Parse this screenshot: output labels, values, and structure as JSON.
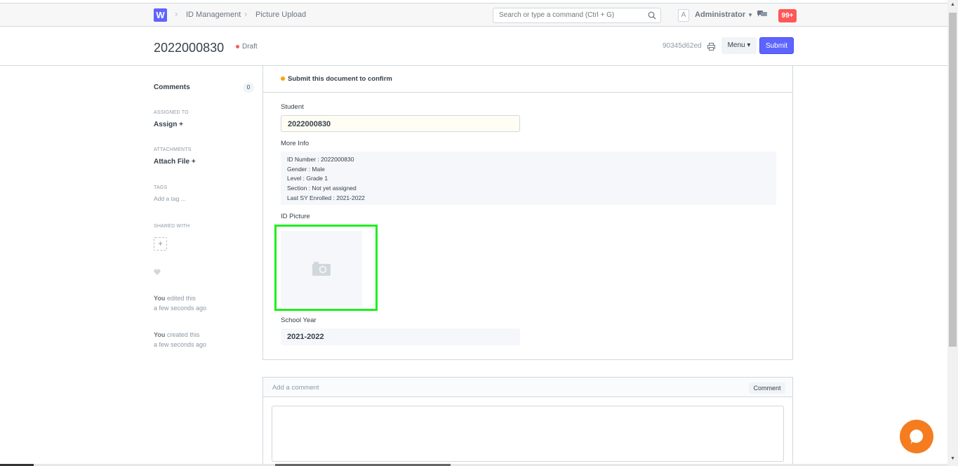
{
  "navbar": {
    "logo": "W",
    "breadcrumbs": [
      "ID Management",
      "Picture Upload"
    ],
    "search_placeholder": "Search or type a command (Ctrl + G)",
    "avatar_letter": "A",
    "user_name": "Administrator",
    "notification_count": "99+"
  },
  "header": {
    "title": "2022000830",
    "status": "Draft",
    "doc_id": "90345d62ed",
    "menu_label": "Menu ▾",
    "submit_label": "Submit"
  },
  "sidebar": {
    "comments_label": "Comments",
    "comments_count": "0",
    "assigned_to_label": "Assigned To",
    "assign_link": "Assign +",
    "attachments_label": "Attachments",
    "attach_link": "Attach File +",
    "tags_label": "Tags",
    "add_tag": "Add a tag ...",
    "shared_with_label": "Shared With",
    "share_add": "+",
    "activity": [
      {
        "who": "You",
        "action": " edited this",
        "when": "a few seconds ago"
      },
      {
        "who": "You",
        "action": " created this",
        "when": "a few seconds ago"
      }
    ]
  },
  "form": {
    "message": "Submit this document to confirm",
    "student_label": "Student",
    "student_value": "2022000830",
    "more_info_label": "More Info",
    "more_info_lines": [
      "ID Number : 2022000830",
      "Gender : Male",
      "Level : Grade 1",
      "Section : Not yet assigned",
      "Last SY Enrolled : 2021-2022"
    ],
    "id_picture_label": "ID Picture",
    "school_year_label": "School Year",
    "school_year_value": "2021-2022"
  },
  "comments": {
    "placeholder": "Add a comment",
    "button_label": "Comment"
  },
  "colors": {
    "primary": "#5e64ff",
    "draft_indicator": "#ff5858",
    "highlight_border": "#1ef01e",
    "chat_bubble": "#f57c1f"
  }
}
